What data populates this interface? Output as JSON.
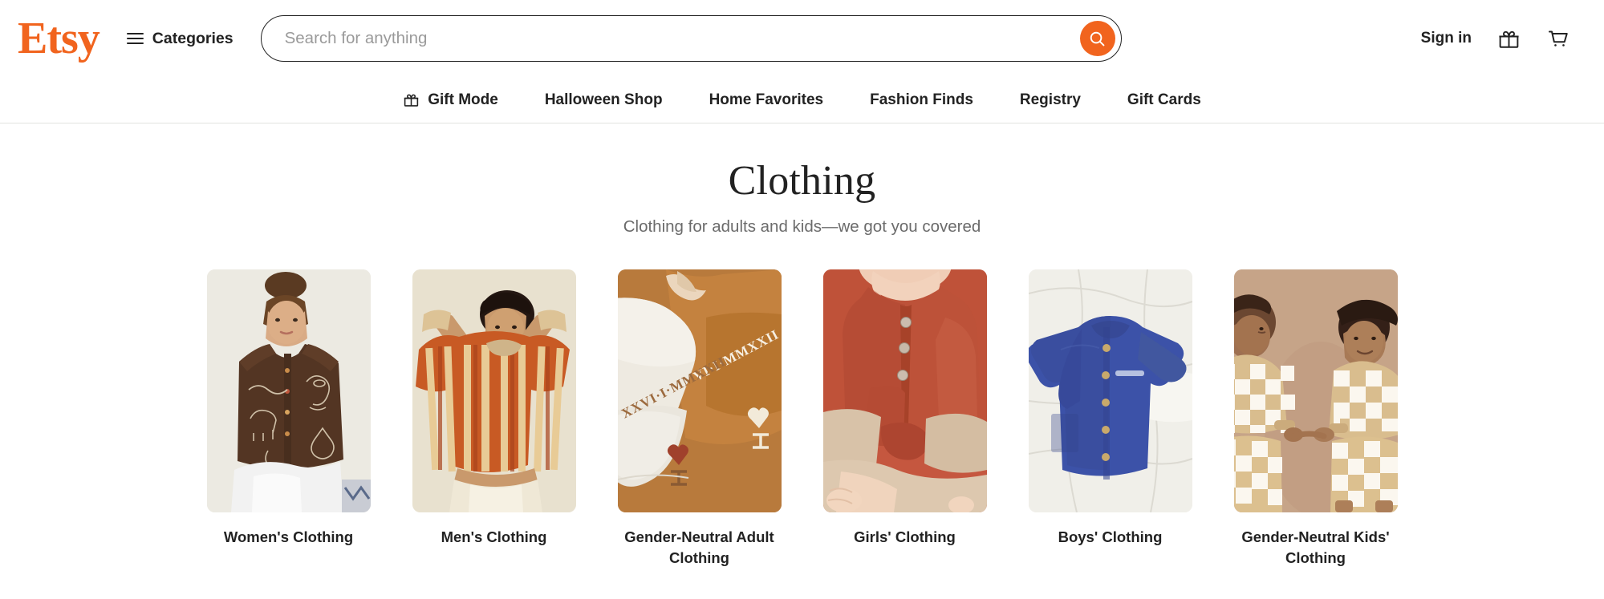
{
  "brand": {
    "logo_text": "Etsy",
    "logo_color": "#F1641E"
  },
  "header": {
    "categories_label": "Categories",
    "categories_icon": "hamburger-menu-icon",
    "search": {
      "placeholder": "Search for anything",
      "value": "",
      "button_icon": "search-icon",
      "button_color": "#F1641E"
    },
    "signin_label": "Sign in",
    "gift_icon": "gift-icon",
    "cart_icon": "shopping-cart-icon"
  },
  "subnav": {
    "items": [
      {
        "label": "Gift Mode",
        "icon": "gift-icon"
      },
      {
        "label": "Halloween Shop",
        "icon": ""
      },
      {
        "label": "Home Favorites",
        "icon": ""
      },
      {
        "label": "Fashion Finds",
        "icon": ""
      },
      {
        "label": "Registry",
        "icon": ""
      },
      {
        "label": "Gift Cards",
        "icon": ""
      }
    ]
  },
  "main": {
    "title": "Clothing",
    "subtitle": "Clothing for adults and kids—we got you covered",
    "cards": [
      {
        "label": "Women's Clothing",
        "image": "woman-in-brown-embroidered-shirt"
      },
      {
        "label": "Men's Clothing",
        "image": "man-in-orange-striped-sweater"
      },
      {
        "label": "Gender-Neutral Adult Clothing",
        "image": "embroidered-roman-numeral-sweatshirts"
      },
      {
        "label": "Girls' Clothing",
        "image": "child-in-rust-red-buttoned-top"
      },
      {
        "label": "Boys' Clothing",
        "image": "blue-muslin-button-shirt-on-linen"
      },
      {
        "label": "Gender-Neutral Kids' Clothing",
        "image": "two-kids-in-checkered-outfits"
      }
    ]
  }
}
